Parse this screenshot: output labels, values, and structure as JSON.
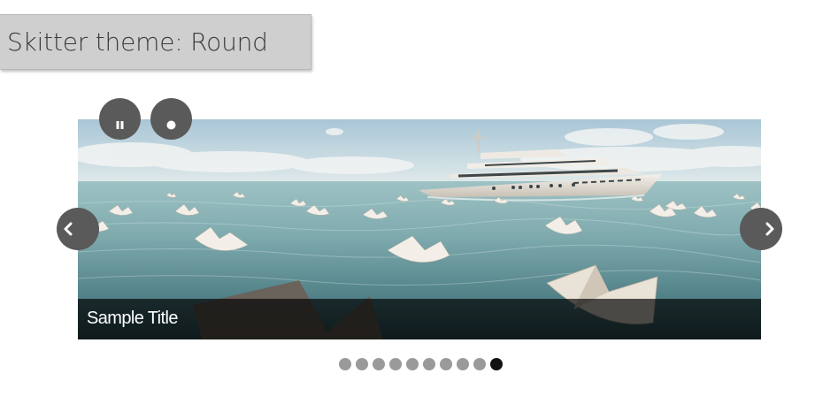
{
  "page": {
    "title": "Skitter theme: Round"
  },
  "slider": {
    "caption": "Sample Title",
    "controls": {
      "pause_icon": "pause-icon",
      "stop_icon": "stop-icon",
      "prev_icon": "chevron-left-icon",
      "next_icon": "chevron-right-icon"
    },
    "dots": {
      "count": 10,
      "active_index": 9,
      "active_color": "#111111",
      "inactive_color": "#9a9a9a"
    }
  },
  "colors": {
    "title_box_bg": "#cfcfcf",
    "button_bg": "#5a5a5a",
    "caption_bg": "rgba(0,0,0,0.68)",
    "caption_text": "#ffffff"
  }
}
